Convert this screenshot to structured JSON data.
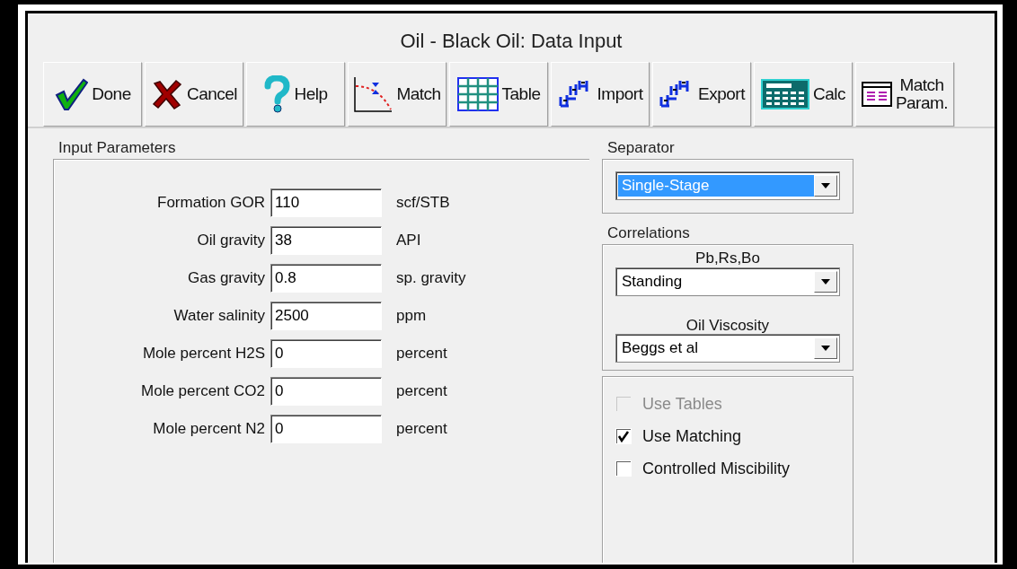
{
  "window": {
    "title": "Oil - Black Oil: Data Input"
  },
  "toolbar": [
    {
      "label": "Done",
      "kind": "check"
    },
    {
      "label": "Cancel",
      "kind": "cross"
    },
    {
      "label": "Help",
      "kind": "question"
    },
    {
      "label": "Match",
      "kind": "curve"
    },
    {
      "label": "Table",
      "kind": "grid"
    },
    {
      "label": "Import",
      "kind": "steps"
    },
    {
      "label": "Export",
      "kind": "steps"
    },
    {
      "label": "Calc",
      "kind": "keypad"
    },
    {
      "label": "Match\nParam.",
      "kind": "form"
    }
  ],
  "input_parameters": {
    "title": "Input Parameters",
    "fields": [
      {
        "label": "Formation GOR",
        "value": "110",
        "unit": "scf/STB"
      },
      {
        "label": "Oil gravity",
        "value": "38",
        "unit": "API"
      },
      {
        "label": "Gas gravity",
        "value": "0.8",
        "unit": "sp. gravity"
      },
      {
        "label": "Water salinity",
        "value": "2500",
        "unit": "ppm"
      },
      {
        "label": "Mole percent H2S",
        "value": "0",
        "unit": "percent"
      },
      {
        "label": "Mole percent CO2",
        "value": "0",
        "unit": "percent"
      },
      {
        "label": "Mole percent N2",
        "value": "0",
        "unit": "percent"
      }
    ]
  },
  "separator": {
    "title": "Separator",
    "value": "Single-Stage",
    "focused": true
  },
  "correlations": {
    "title": "Correlations",
    "selects": [
      {
        "label": "Pb,Rs,Bo",
        "value": "Standing",
        "focused": false
      },
      {
        "label": "Oil Viscosity",
        "value": "Beggs et al",
        "focused": false
      }
    ]
  },
  "options": [
    {
      "label": "Use Tables",
      "checked": false,
      "disabled": true
    },
    {
      "label": "Use Matching",
      "checked": true,
      "disabled": false
    },
    {
      "label": "Controlled Miscibility",
      "checked": false,
      "disabled": false
    }
  ]
}
